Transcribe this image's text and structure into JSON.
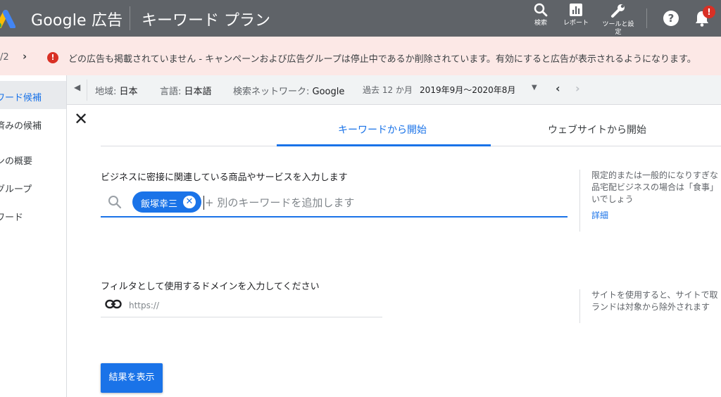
{
  "header": {
    "brand": "Google 広告",
    "page_title": "キーワード プラン",
    "tools": [
      {
        "label": "検索",
        "icon": "search-icon"
      },
      {
        "label": "レポート",
        "icon": "report-icon"
      },
      {
        "label": "ツールと設\n定",
        "icon": "wrench-icon"
      }
    ],
    "help_glyph": "?",
    "notification_badge": "!"
  },
  "alert": {
    "pager": "/2",
    "pager_next": "›",
    "icon_glyph": "!",
    "message": "どの広告も掲載されていません - キャンペーンおよび広告グループは停止中であるか削除されています。有効にすると広告が表示されるようになります。"
  },
  "sidebar": {
    "items": [
      {
        "label": "ワード候補",
        "active": true
      },
      {
        "label": "済みの候補",
        "active": false
      },
      {
        "label": "ンの概要",
        "active": false
      },
      {
        "label": "グループ",
        "active": false
      },
      {
        "label": "ワード",
        "active": false
      }
    ]
  },
  "filters": {
    "location_label": "地域:",
    "location_value": "日本",
    "language_label": "言語:",
    "language_value": "日本語",
    "network_label": "検索ネットワーク:",
    "network_value": "Google",
    "period_label": "過去 12 か月",
    "period_value": "2019年9月～2020年8月"
  },
  "panel": {
    "close_glyph": "✕",
    "tabs": {
      "keywords": "キーワードから開始",
      "website": "ウェブサイトから開始"
    },
    "keyword_prompt": "ビジネスに密接に関連している商品やサービスを入力します",
    "keyword_chip": "飯塚幸三",
    "keyword_placeholder": "+ 別のキーワードを追加します",
    "keyword_hint_lines": [
      "限定的または一般的になりすぎな",
      "品宅配ビジネスの場合は「食事」",
      "いでしょう"
    ],
    "keyword_hint_link": "詳細",
    "domain_prompt": "フィルタとして使用するドメインを入力してください",
    "domain_placeholder": "https://",
    "domain_hint_lines": [
      "サイトを使用すると、サイトで取",
      "ランドは対象から除外されます"
    ],
    "submit_label": "結果を表示"
  },
  "colors": {
    "header_bg": "#5f6368",
    "alert_bg": "#fce8e6",
    "accent": "#1a73e8",
    "error": "#d93025"
  }
}
